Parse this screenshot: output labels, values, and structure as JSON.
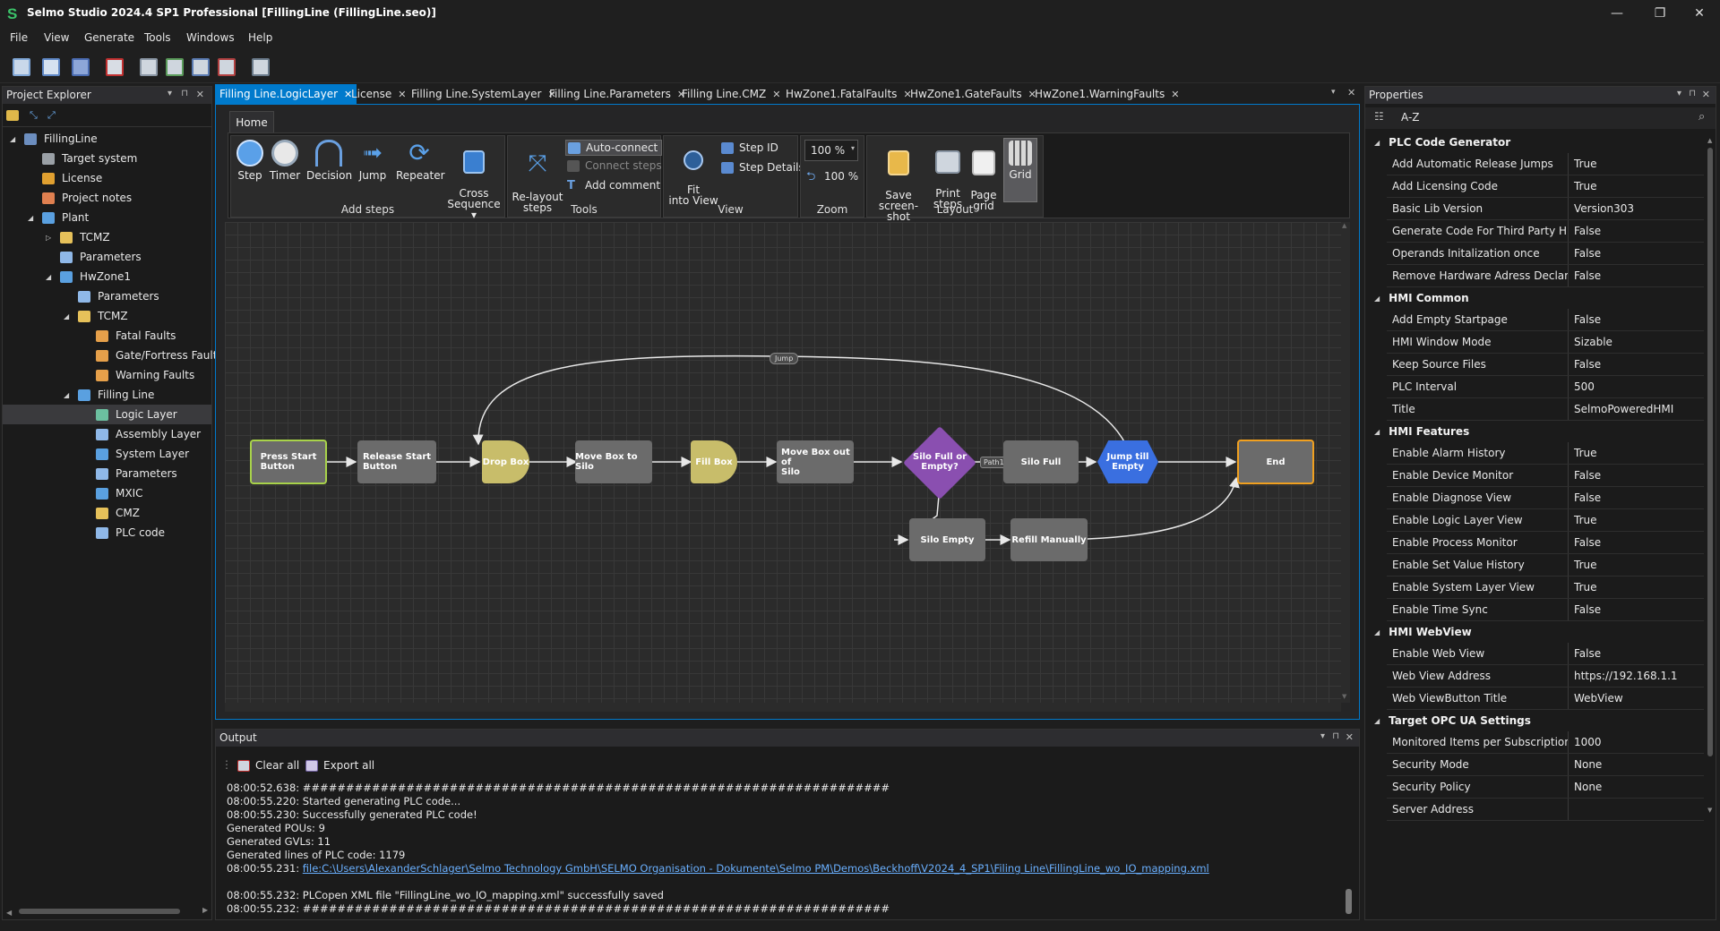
{
  "window": {
    "title": "Selmo Studio 2024.4 SP1 Professional  [FillingLine (FillingLine.seo)]",
    "logo": "S",
    "minimize": "—",
    "restore": "❐",
    "close": "✕"
  },
  "menu": [
    "File",
    "View",
    "Generate",
    "Tools",
    "Windows",
    "Help"
  ],
  "project_explorer": {
    "title": "Project Explorer",
    "tree": [
      {
        "label": "FillingLine",
        "icon": "project-icon",
        "color": "#6c8ebf"
      },
      {
        "label": "Target system",
        "icon": "target-system-icon",
        "color": "#9aa0a6"
      },
      {
        "label": "License",
        "icon": "key-icon",
        "color": "#e0a030"
      },
      {
        "label": "Project notes",
        "icon": "notes-icon",
        "color": "#e08050"
      },
      {
        "label": "Plant",
        "icon": "plant-icon",
        "color": "#5aa0e0"
      },
      {
        "label": "TCMZ",
        "icon": "folder-icon",
        "color": "#e6c15a"
      },
      {
        "label": "Parameters",
        "icon": "parameters-icon",
        "color": "#8fb8e8"
      },
      {
        "label": "HwZone1",
        "icon": "zone-icon",
        "color": "#5aa0e0"
      },
      {
        "label": "Parameters",
        "icon": "parameters-icon",
        "color": "#8fb8e8"
      },
      {
        "label": "TCMZ",
        "icon": "folder-icon",
        "color": "#e6c15a"
      },
      {
        "label": "Fatal Faults",
        "icon": "fault-folder-icon",
        "color": "#e6a04a"
      },
      {
        "label": "Gate/Fortress Faults",
        "icon": "fault-folder-icon",
        "color": "#e6a04a"
      },
      {
        "label": "Warning Faults",
        "icon": "fault-folder-icon",
        "color": "#e6a04a"
      },
      {
        "label": "Filling Line",
        "icon": "sequence-icon",
        "color": "#5aa0e0"
      },
      {
        "label": "Logic Layer",
        "icon": "logic-layer-icon",
        "color": "#6cc0a0"
      },
      {
        "label": "Assembly Layer",
        "icon": "assembly-layer-icon",
        "color": "#8fb8e8"
      },
      {
        "label": "System Layer",
        "icon": "system-layer-icon",
        "color": "#5aa0e0"
      },
      {
        "label": "Parameters",
        "icon": "parameters-icon",
        "color": "#8fb8e8"
      },
      {
        "label": "MXIC",
        "icon": "mxic-icon",
        "color": "#5aa0e0"
      },
      {
        "label": "CMZ",
        "icon": "folder-icon",
        "color": "#e6c15a"
      },
      {
        "label": "PLC code",
        "icon": "code-icon",
        "color": "#8fb8e8"
      }
    ]
  },
  "tabs": [
    {
      "label": "Filling Line.LogicLayer",
      "active": true
    },
    {
      "label": "License"
    },
    {
      "label": "Filling Line.SystemLayer"
    },
    {
      "label": "Filling Line.Parameters"
    },
    {
      "label": "Filling Line.CMZ"
    },
    {
      "label": "HwZone1.FatalFaults"
    },
    {
      "label": "HwZone1.GateFaults"
    },
    {
      "label": "HwZone1.WarningFaults"
    }
  ],
  "ribbon": {
    "home_tab": "Home",
    "add_steps": {
      "label": "Add steps",
      "buttons": [
        "Step",
        "Timer",
        "Decision",
        "Jump",
        "Repeater",
        "Cross\nSequence ▾"
      ]
    },
    "tools": {
      "label": "Tools",
      "relayout": "Re-layout\nsteps",
      "auto_connect": "Auto-connect",
      "connect_steps": "Connect steps",
      "add_comment": "Add comment"
    },
    "view": {
      "label": "View",
      "fit": "Fit\ninto View",
      "step_id": "Step ID",
      "step_details": "Step Details"
    },
    "zoom": {
      "label": "Zoom",
      "value": "100 %",
      "reset": "100 %"
    },
    "layout": {
      "label": "Layout",
      "buttons": [
        "Save\nscreen-shot",
        "Print\nsteps",
        "Page\ngrid",
        "Grid"
      ]
    }
  },
  "diagram": {
    "nodes": [
      {
        "id": "press-start",
        "label": "Press Start\nButton",
        "kind": "start"
      },
      {
        "id": "release-start",
        "label": "Release Start\nButton",
        "kind": "step"
      },
      {
        "id": "drop-box",
        "label": "Drop Box",
        "kind": "timer"
      },
      {
        "id": "move-box-silo",
        "label": "Move Box to Silo",
        "kind": "step"
      },
      {
        "id": "fill-box",
        "label": "Fill Box",
        "kind": "timer"
      },
      {
        "id": "move-box-out",
        "label": "Move Box out of\nSilo",
        "kind": "step"
      },
      {
        "id": "silo-decision",
        "label": "Silo Full or\nEmpty?",
        "kind": "decision"
      },
      {
        "id": "silo-full",
        "label": "Silo Full",
        "kind": "step"
      },
      {
        "id": "jump-empty",
        "label": "Jump till\nEmpty",
        "kind": "jump"
      },
      {
        "id": "end",
        "label": "End",
        "kind": "end"
      },
      {
        "id": "silo-empty",
        "label": "Silo Empty",
        "kind": "step"
      },
      {
        "id": "refill",
        "label": "Refill Manually",
        "kind": "step"
      }
    ],
    "jump_label": "Jump",
    "path_label": "Path1",
    "colors": {
      "start_border": "#a8d24a",
      "end_border": "#f0a020",
      "timer": "#c8bd6a",
      "decision": "#8a4fb0",
      "jump": "#3a6fe0",
      "step": "#6b6b6b"
    }
  },
  "output": {
    "title": "Output",
    "clear_all": "Clear all",
    "export_all": "Export all",
    "lines": [
      {
        "text": "08:00:52.638: ####################################################################"
      },
      {
        "text": "08:00:55.220: Started generating PLC code..."
      },
      {
        "text": "08:00:55.230: Successfully generated PLC code!"
      },
      {
        "text": "Generated POUs: 9"
      },
      {
        "text": "Generated GVLs: 11"
      },
      {
        "text": "Generated lines of PLC code: 1179"
      },
      {
        "prefix": "08:00:55.231: ",
        "link": "file:C:\\Users\\AlexanderSchlager\\Selmo Technology GmbH\\SELMO Organisation - Dokumente\\Selmo PM\\Demos\\Beckhoff\\V2024_4_SP1\\Filing Line\\FillingLine_wo_IO_mapping.xml"
      },
      {
        "text": ""
      },
      {
        "text": "08:00:55.232: PLCopen XML file \"FillingLine_wo_IO_mapping.xml\" successfully saved"
      },
      {
        "text": "08:00:55.232: ####################################################################"
      }
    ]
  },
  "properties": {
    "title": "Properties",
    "sort_label": "A-Z",
    "categories": [
      {
        "name": "PLC Code Generator",
        "props": [
          [
            "Add Automatic Release Jumps",
            "True"
          ],
          [
            "Add Licensing Code",
            "True"
          ],
          [
            "Basic Lib Version",
            "Version303"
          ],
          [
            "Generate Code For Third Party HMI",
            "False"
          ],
          [
            "Operands Initalization once",
            "False"
          ],
          [
            "Remove Hardware Adress Declaration",
            "False"
          ]
        ]
      },
      {
        "name": "HMI Common",
        "props": [
          [
            "Add Empty Startpage",
            "False"
          ],
          [
            "HMI Window Mode",
            "Sizable"
          ],
          [
            "Keep Source Files",
            "False"
          ],
          [
            "PLC Interval",
            "500"
          ],
          [
            "Title",
            "SelmoPoweredHMI"
          ]
        ]
      },
      {
        "name": "HMI Features",
        "props": [
          [
            "Enable Alarm History",
            "True"
          ],
          [
            "Enable Device Monitor",
            "False"
          ],
          [
            "Enable Diagnose View",
            "False"
          ],
          [
            "Enable Logic Layer View",
            "True"
          ],
          [
            "Enable Process Monitor",
            "False"
          ],
          [
            "Enable Set Value History",
            "True"
          ],
          [
            "Enable System Layer View",
            "True"
          ],
          [
            "Enable Time Sync",
            "False"
          ]
        ]
      },
      {
        "name": "HMI WebView",
        "props": [
          [
            "Enable Web View",
            "False"
          ],
          [
            "Web View Address",
            "https://192.168.1.1"
          ],
          [
            "Web ViewButton Title",
            "WebView"
          ]
        ]
      },
      {
        "name": "Target OPC UA Settings",
        "props": [
          [
            "Monitored Items per Subscription",
            "1000"
          ],
          [
            "Security Mode",
            "None"
          ],
          [
            "Security Policy",
            "None"
          ],
          [
            "Server Address",
            ""
          ]
        ]
      }
    ]
  }
}
